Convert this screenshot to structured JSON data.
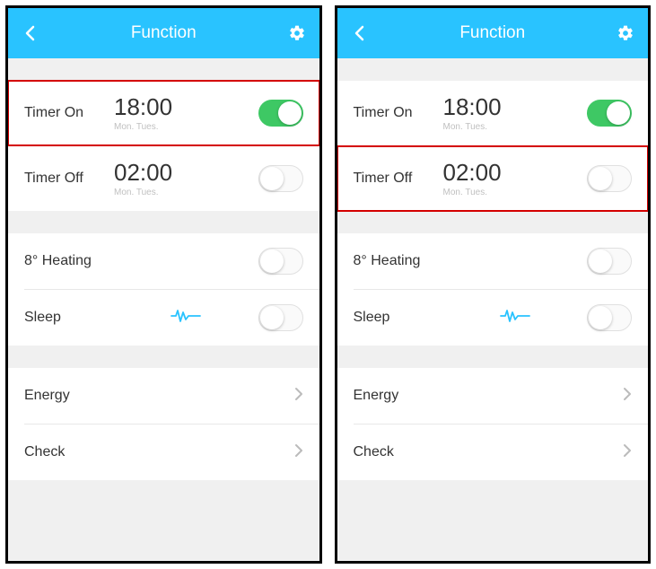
{
  "header": {
    "title": "Function"
  },
  "screens": [
    {
      "highlight_row": "timer-on",
      "rows": {
        "timer_on": {
          "label": "Timer On",
          "time": "18:00",
          "days": "Mon. Tues.",
          "toggle_on": true
        },
        "timer_off": {
          "label": "Timer Off",
          "time": "02:00",
          "days": "Mon. Tues.",
          "toggle_on": false
        },
        "heating": {
          "label": "8° Heating",
          "toggle_on": false
        },
        "sleep": {
          "label": "Sleep",
          "toggle_on": false,
          "icon": "wave-icon"
        },
        "energy": {
          "label": "Energy"
        },
        "check": {
          "label": "Check"
        }
      }
    },
    {
      "highlight_row": "timer-off",
      "rows": {
        "timer_on": {
          "label": "Timer On",
          "time": "18:00",
          "days": "Mon. Tues.",
          "toggle_on": true
        },
        "timer_off": {
          "label": "Timer Off",
          "time": "02:00",
          "days": "Mon. Tues.",
          "toggle_on": false
        },
        "heating": {
          "label": "8° Heating",
          "toggle_on": false
        },
        "sleep": {
          "label": "Sleep",
          "toggle_on": false,
          "icon": "wave-icon"
        },
        "energy": {
          "label": "Energy"
        },
        "check": {
          "label": "Check"
        }
      }
    }
  ]
}
